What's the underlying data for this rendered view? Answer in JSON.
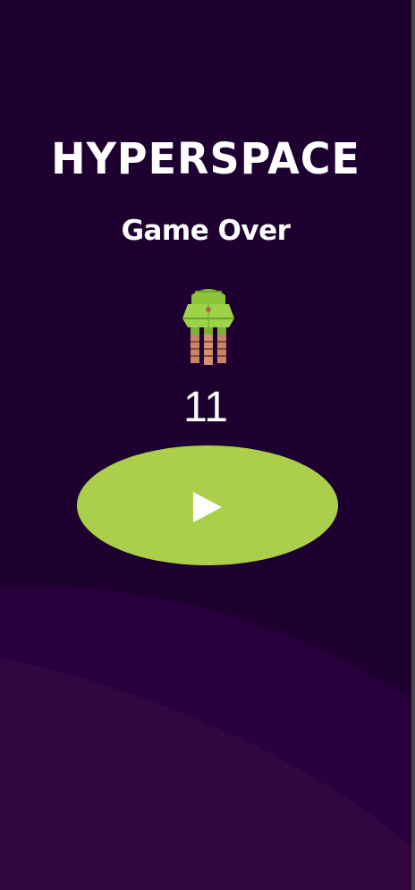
{
  "game": {
    "title": "HYPERSPACE",
    "status": "Game Over",
    "score": "11"
  },
  "icons": {
    "player": "rocket-ship-icon",
    "play": "play-icon"
  },
  "colors": {
    "background": "#1e0030",
    "wave_mid": "#27003c",
    "wave_front": "#310641",
    "accent": "#abcf4a",
    "text": "#ffffff"
  }
}
